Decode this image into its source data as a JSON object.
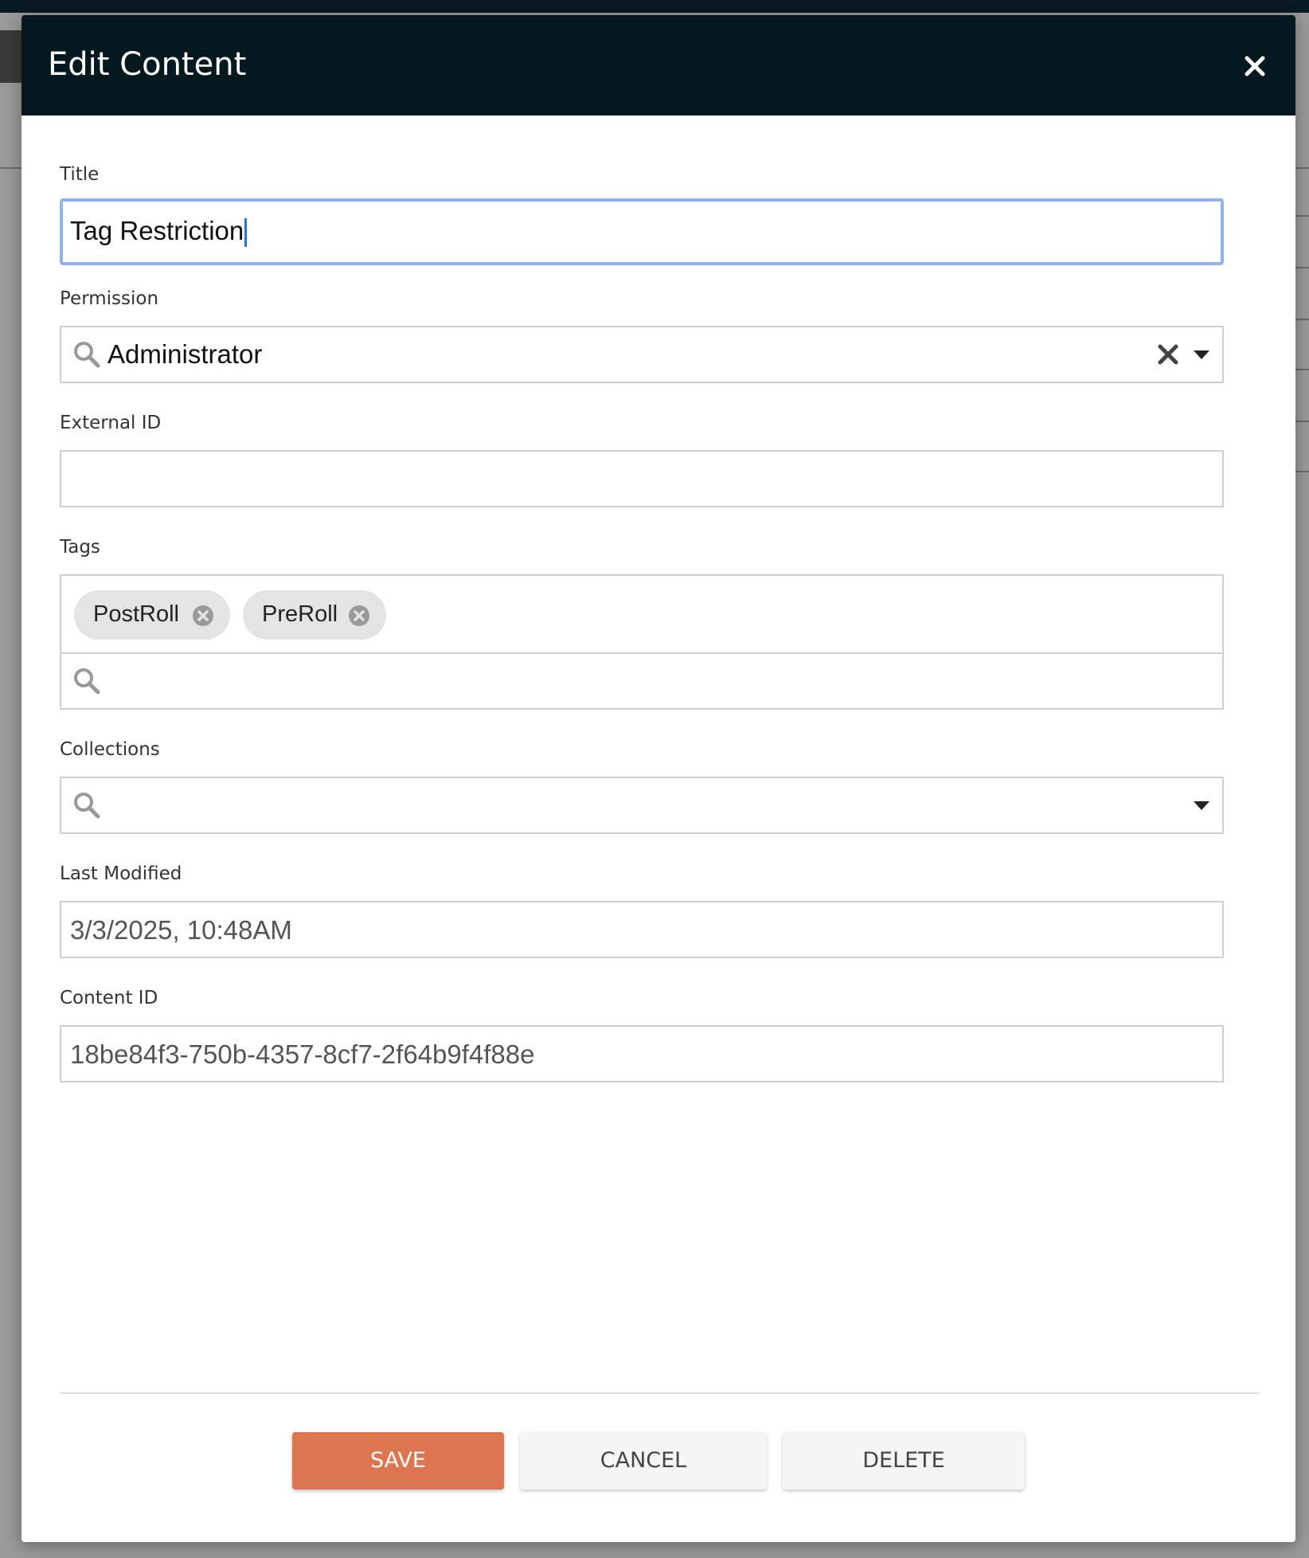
{
  "modal": {
    "title": "Edit Content"
  },
  "fields": {
    "title": {
      "label": "Title",
      "value": "Tag Restriction"
    },
    "permission": {
      "label": "Permission",
      "value": "Administrator"
    },
    "external_id": {
      "label": "External ID",
      "value": ""
    },
    "tags": {
      "label": "Tags",
      "items": [
        "PostRoll",
        "PreRoll"
      ]
    },
    "collections": {
      "label": "Collections",
      "value": ""
    },
    "last_modified": {
      "label": "Last Modified",
      "value": "3/3/2025, 10:48AM"
    },
    "content_id": {
      "label": "Content ID",
      "value": "18be84f3-750b-4357-8cf7-2f64b9f4f88e"
    }
  },
  "buttons": {
    "save": "SAVE",
    "cancel": "CANCEL",
    "delete": "DELETE"
  },
  "icons": {
    "close": "close-icon",
    "search": "search-icon",
    "clear": "clear-icon",
    "dropdown": "chevron-down-icon",
    "tag_remove": "remove-tag-icon"
  },
  "colors": {
    "header_bg": "#041820",
    "save_bg": "#dc7550",
    "focus_border": "#8fb2f0",
    "caret": "#2a6fdb"
  }
}
